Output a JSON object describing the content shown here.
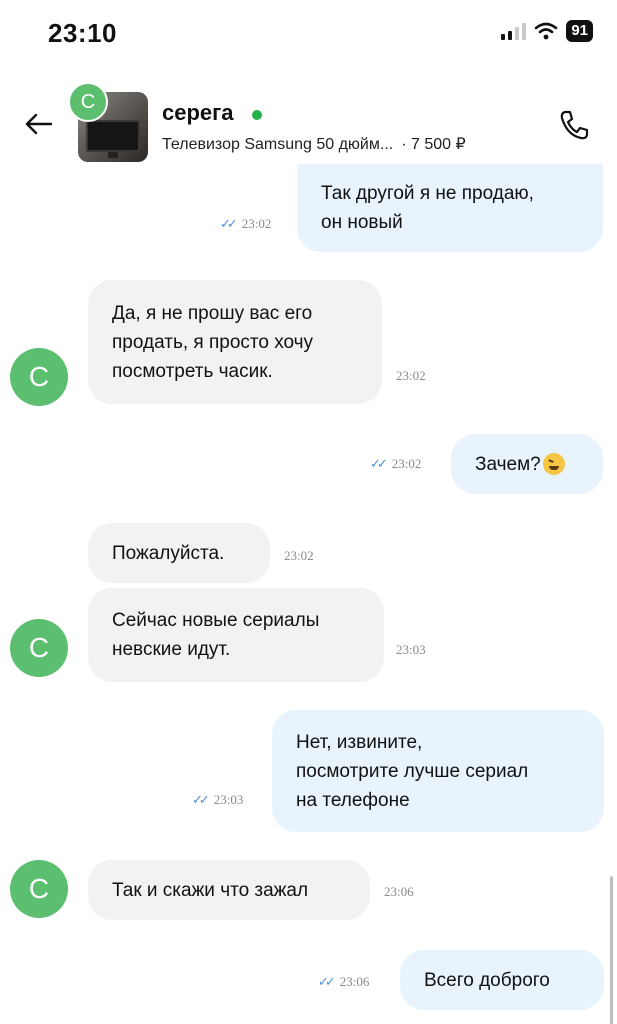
{
  "status_bar": {
    "time": "23:10",
    "battery": "91"
  },
  "header": {
    "avatar_letter": "С",
    "name": "серега",
    "listing_title": "Телевизор Samsung 50 дюйм...",
    "price": "· 7 500 ₽"
  },
  "messages": [
    {
      "dir": "out",
      "text": "Так другой я не продаю,\nон новый",
      "time": "23:02"
    },
    {
      "dir": "in",
      "text": "Да, я не прошу вас его\nпродать, я просто хочу\nпосмотреть часик.",
      "time": "23:02"
    },
    {
      "dir": "out",
      "text": "Зачем?",
      "emoji": "grinning-squinting-face",
      "time": "23:02"
    },
    {
      "dir": "in",
      "text": "Пожалуйста.",
      "time": "23:02"
    },
    {
      "dir": "in",
      "text": "Сейчас новые сериалы\nневские идут.",
      "time": "23:03"
    },
    {
      "dir": "out",
      "text": "Нет, извините,\nпосмотрите лучше сериал\nна телефоне",
      "time": "23:03"
    },
    {
      "dir": "in",
      "text": "Так и скажи что зажал",
      "time": "23:06"
    },
    {
      "dir": "out",
      "text": "Всего доброго",
      "time": "23:06"
    }
  ],
  "avatar_letter": "С",
  "colors": {
    "accent_green": "#5cbf6f",
    "outgoing_bubble": "#e8f3fd",
    "incoming_bubble": "#f2f2f2",
    "read_ticks": "#4a8fd6"
  }
}
